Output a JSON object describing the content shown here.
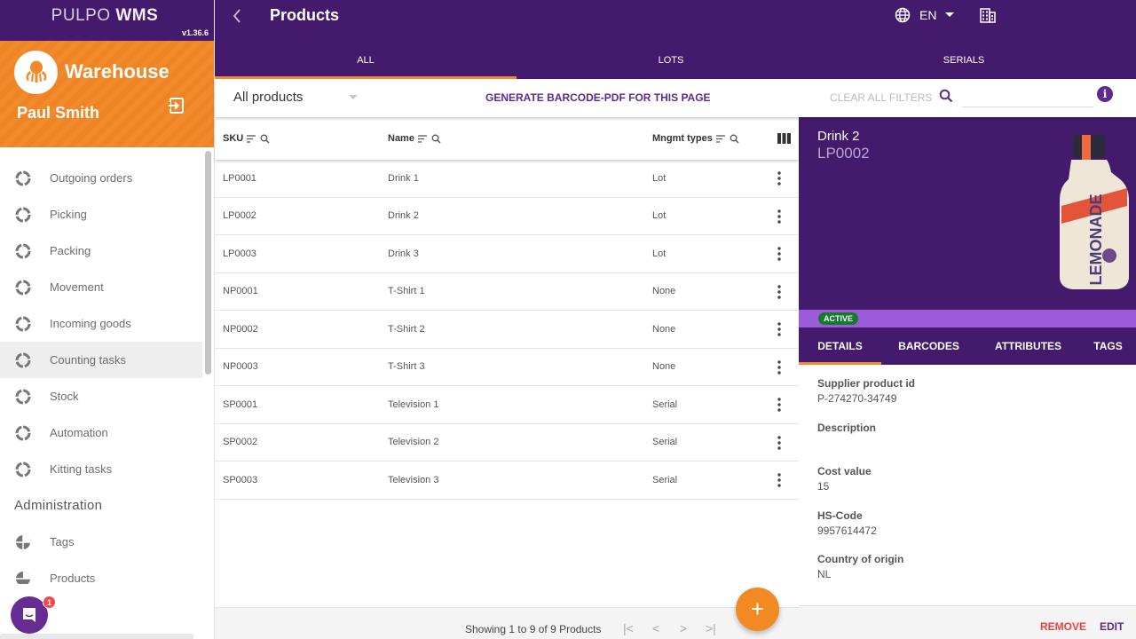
{
  "app": {
    "brand_light": "PULPO",
    "brand_bold": "WMS",
    "version": "v1.36.6",
    "warehouse_label": "Warehouse",
    "user_name": "Paul Smith"
  },
  "sidebar": {
    "items": [
      {
        "label": "Outgoing orders",
        "icon": "loading-ring-icon"
      },
      {
        "label": "Picking",
        "icon": "loading-ring-icon"
      },
      {
        "label": "Packing",
        "icon": "loading-ring-icon"
      },
      {
        "label": "Movement",
        "icon": "loading-ring-icon"
      },
      {
        "label": "Incoming goods",
        "icon": "loading-ring-icon"
      },
      {
        "label": "Counting tasks",
        "icon": "loading-ring-icon",
        "active": true
      },
      {
        "label": "Stock",
        "icon": "loading-ring-icon"
      },
      {
        "label": "Automation",
        "icon": "loading-ring-icon"
      },
      {
        "label": "Kitting tasks",
        "icon": "loading-ring-icon"
      }
    ],
    "section_header": "Administration",
    "admin_items": [
      {
        "label": "Tags",
        "icon": "pie-segment-icon"
      },
      {
        "label": "Products",
        "icon": "pie-segment-icon"
      }
    ],
    "chat_badge_count": "1"
  },
  "header": {
    "title": "Products",
    "language": "EN"
  },
  "tabs": [
    {
      "label": "ALL",
      "active": true
    },
    {
      "label": "LOTS"
    },
    {
      "label": "SERIALS"
    }
  ],
  "filterbar": {
    "select_value": "All products",
    "generate_label": "GENERATE BARCODE-PDF FOR THIS PAGE",
    "clear_filters_label": "CLEAR ALL FILTERS",
    "search_placeholder": "",
    "search_value": ""
  },
  "table": {
    "columns": [
      "SKU",
      "Name",
      "Mngmt types"
    ],
    "rows": [
      {
        "sku": "LP0001",
        "name": "Drink 1",
        "type": "Lot"
      },
      {
        "sku": "LP0002",
        "name": "Drink 2",
        "type": "Lot"
      },
      {
        "sku": "LP0003",
        "name": "Drink 3",
        "type": "Lot"
      },
      {
        "sku": "NP0001",
        "name": "T-Shirt 1",
        "type": "None"
      },
      {
        "sku": "NP0002",
        "name": "T-Shirt 2",
        "type": "None"
      },
      {
        "sku": "NP0003",
        "name": "T-Shirt 3",
        "type": "None"
      },
      {
        "sku": "SP0001",
        "name": "Television 1",
        "type": "Serial"
      },
      {
        "sku": "SP0002",
        "name": "Television 2",
        "type": "Serial"
      },
      {
        "sku": "SP0003",
        "name": "Television 3",
        "type": "Serial"
      }
    ],
    "showing": "Showing 1 to 9 of 9 Products",
    "pager": {
      "first": "|<",
      "prev": "<",
      "next": ">",
      "last": ">|"
    },
    "fab_label": "+"
  },
  "detail": {
    "name": "Drink 2",
    "sku": "LP0002",
    "status": "ACTIVE",
    "tabs": [
      {
        "label": "DETAILS",
        "active": true
      },
      {
        "label": "BARCODES"
      },
      {
        "label": "ATTRIBUTES"
      },
      {
        "label": "TAGS"
      }
    ],
    "fields": [
      {
        "label": "Supplier product id",
        "value": "P-274270-34749"
      },
      {
        "label": "Description",
        "value": ""
      },
      {
        "label": "Cost value",
        "value": "15"
      },
      {
        "label": "HS-Code",
        "value": "9957614472"
      },
      {
        "label": "Country of origin",
        "value": "NL"
      }
    ],
    "remove_label": "REMOVE",
    "edit_label": "EDIT",
    "image_label": "LEMONADE"
  },
  "colors": {
    "primary": "#441a6c",
    "accent": "#f18a2b",
    "status_active": "#157a2f",
    "danger": "#f0423c"
  }
}
